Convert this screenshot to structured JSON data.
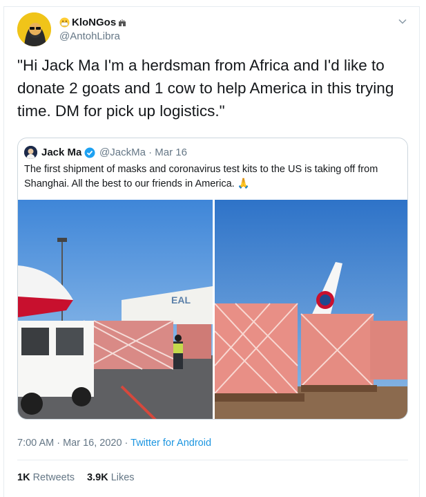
{
  "tweet": {
    "display_name": "KloNGos",
    "handle": "@AntohLibra",
    "text": "\"Hi Jack Ma I'm a herdsman from Africa and I'd like to donate 2 goats and 1 cow to help America in this trying time. DM for pick up logistics.\"",
    "timestamp": "7:00 AM · Mar 16, 2020 · ",
    "client": "Twitter for Android",
    "retweets_count": "1K",
    "retweets_label": "Retweets",
    "likes_count": "3.9K",
    "likes_label": "Likes"
  },
  "quoted_tweet": {
    "display_name": "Jack Ma",
    "handle_date": "@JackMa · Mar 16",
    "text": "The first shipment of masks and coronavirus test kits to the US is taking off from Shanghai. All the best to our friends in America. 🙏",
    "left_image_sign": "EAL"
  },
  "icons": [
    "mask-face-emoji-icon",
    "castle-emoji-icon",
    "chevron-down-icon",
    "verified-badge-icon"
  ],
  "colors": {
    "link": "#1b95e0",
    "secondary": "#657786",
    "verified": "#1da1f2",
    "border": "#ccd6dd"
  }
}
